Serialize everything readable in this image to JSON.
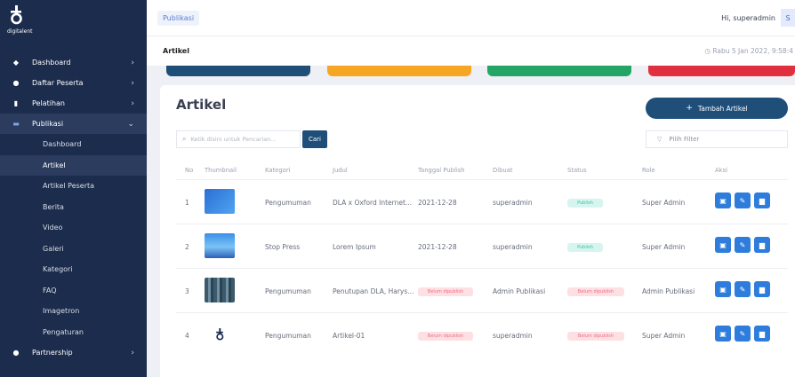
{
  "brand": {
    "logo_text": "digitalent"
  },
  "sidebar": {
    "items": [
      {
        "label": "Dashboard",
        "icon": "diamond-icon"
      },
      {
        "label": "Daftar Peserta",
        "icon": "users-icon"
      },
      {
        "label": "Pelatihan",
        "icon": "book-icon"
      },
      {
        "label": "Publikasi",
        "icon": "newspaper-icon"
      }
    ],
    "publikasi_sub": [
      "Dashboard",
      "Artikel",
      "Artikel Peserta",
      "Berita",
      "Video",
      "Galeri",
      "Kategori",
      "FAQ",
      "Imagetron",
      "Pengaturan"
    ],
    "partnership": {
      "label": "Partnership",
      "icon": "handshake-icon"
    }
  },
  "topbar": {
    "breadcrumb": "Publikasi",
    "greeting": "Hi, superadmin",
    "avatar_initial": "S"
  },
  "subbar": {
    "page": "Artikel",
    "datetime": "Rabu 5 Jan 2022, 9:58:4"
  },
  "cards": {
    "colors": [
      "#1f4e79",
      "#f5a623",
      "#22a565",
      "#e0303f"
    ]
  },
  "panel": {
    "title": "Artikel",
    "add_button": "Tambah Artikel",
    "search_placeholder": "Ketik disini untuk Pencarian...",
    "search_button": "Cari",
    "filter_placeholder": "Pilih Filter"
  },
  "table": {
    "headers": [
      "No",
      "Thumbnail",
      "Kategori",
      "Judul",
      "Tanggal Publish",
      "Dibuat",
      "Status",
      "Role",
      "Aksi"
    ],
    "rows": [
      {
        "no": "1",
        "kategori": "Pengumuman",
        "judul": "DLA x Oxford Internet...",
        "tanggal": "2021-12-28",
        "dibuat": "superadmin",
        "status": "Publish",
        "status_type": "pub",
        "role": "Super Admin"
      },
      {
        "no": "2",
        "kategori": "Stop Press",
        "judul": "Lorem Ipsum",
        "tanggal": "2021-12-28",
        "dibuat": "superadmin",
        "status": "Publish",
        "status_type": "pub",
        "role": "Super Admin"
      },
      {
        "no": "3",
        "kategori": "Pengumuman",
        "judul": "Penutupan DLA, Harys...",
        "tanggal": "Belum dipublish",
        "dibuat": "Admin Publikasi",
        "status": "Belum dipublish",
        "status_type": "unpub",
        "role": "Admin Publikasi"
      },
      {
        "no": "4",
        "kategori": "Pengumuman",
        "judul": "Artikel-01",
        "tanggal": "Belum dipublish",
        "dibuat": "superadmin",
        "status": "Belum dipublish",
        "status_type": "unpub",
        "role": "Super Admin"
      }
    ]
  }
}
